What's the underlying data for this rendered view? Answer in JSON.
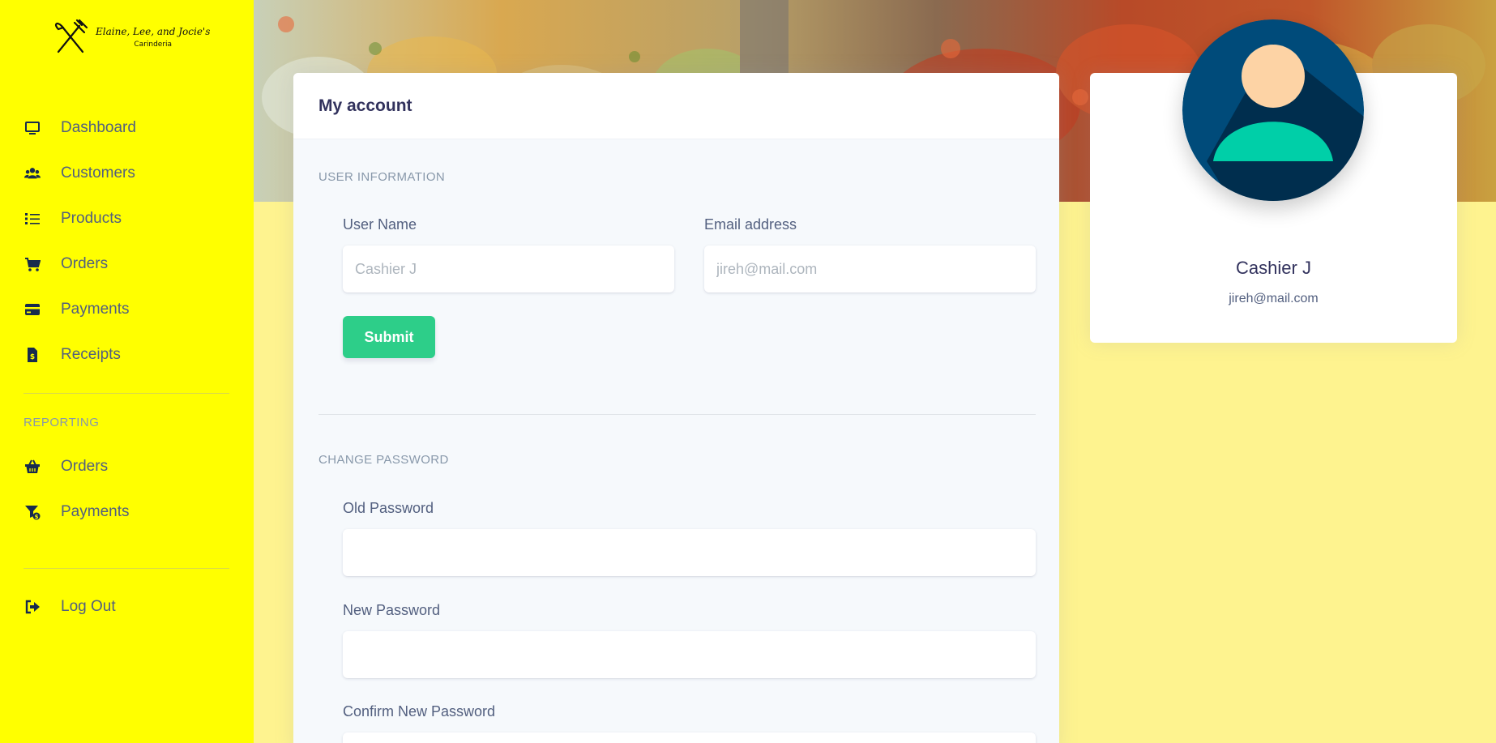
{
  "brand": {
    "name": "Elaine, Lee, and Jocie's",
    "subtitle": "Carinderia"
  },
  "sidebar": {
    "main_items": [
      {
        "label": "Dashboard",
        "icon": "monitor-icon"
      },
      {
        "label": "Customers",
        "icon": "users-icon"
      },
      {
        "label": "Products",
        "icon": "list-icon"
      },
      {
        "label": "Orders",
        "icon": "cart-icon"
      },
      {
        "label": "Payments",
        "icon": "credit-card-icon"
      },
      {
        "label": "Receipts",
        "icon": "receipt-icon"
      }
    ],
    "reporting_heading": "Reporting",
    "reporting_items": [
      {
        "label": "Orders",
        "icon": "basket-icon"
      },
      {
        "label": "Payments",
        "icon": "funnel-dollar-icon"
      }
    ],
    "logout": {
      "label": "Log Out",
      "icon": "sign-out-icon"
    }
  },
  "account": {
    "title": "My account",
    "user_section": "User information",
    "username_label": "User Name",
    "username_placeholder": "Cashier J",
    "email_label": "Email address",
    "email_placeholder": "jireh@mail.com",
    "submit_label": "Submit",
    "password_section": "Change Password",
    "old_password_label": "Old Password",
    "new_password_label": "New Password",
    "confirm_password_label": "Confirm New Password"
  },
  "profile": {
    "name": "Cashier J",
    "email": "jireh@mail.com"
  },
  "colors": {
    "sidebar_bg": "#ffff00",
    "page_bg": "#fef38f",
    "success": "#2dce89",
    "avatar_bg": "#004b7a",
    "avatar_body": "#00cfa8",
    "avatar_skin": "#fdd3a5"
  }
}
